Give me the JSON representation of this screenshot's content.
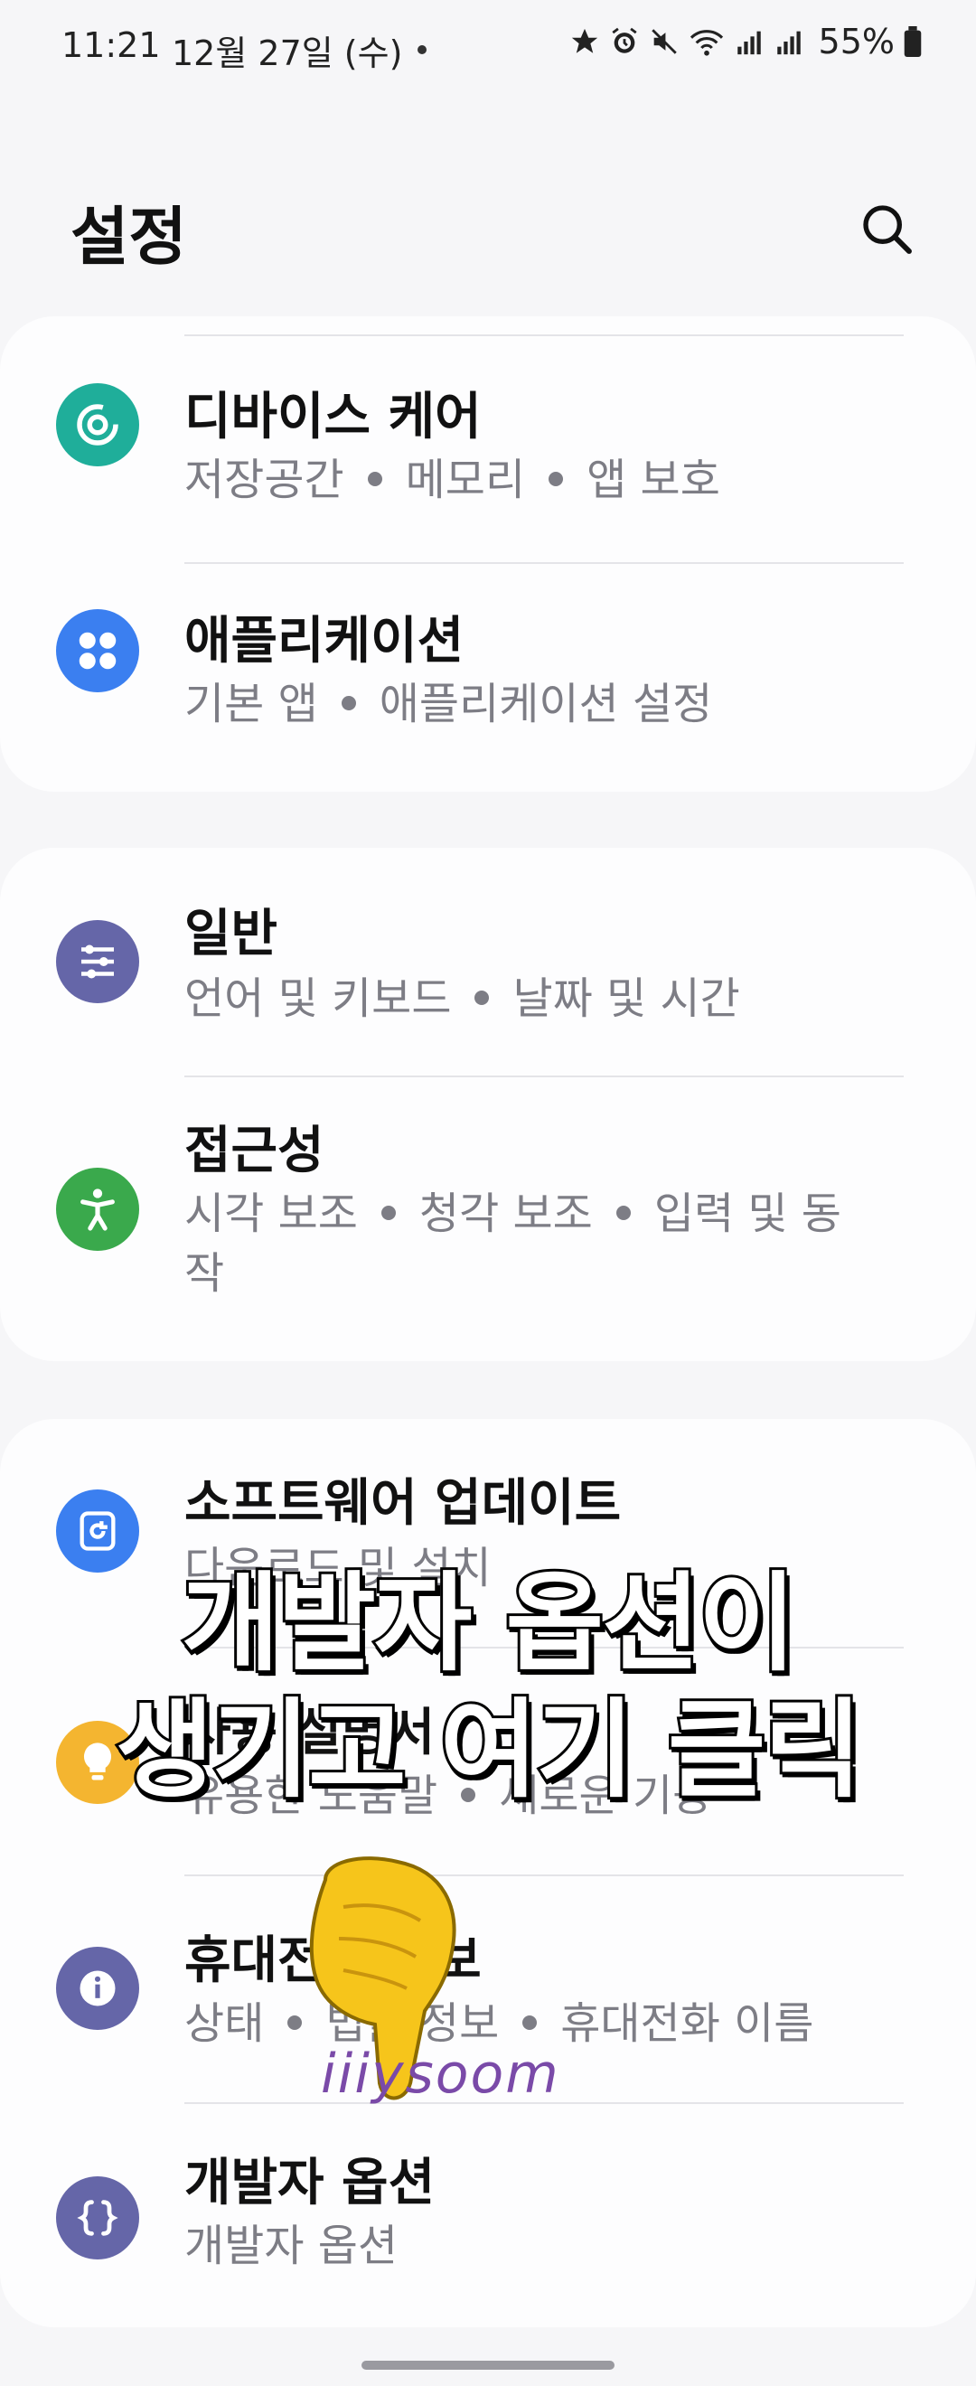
{
  "status_bar": {
    "time": "11:21",
    "date": "12월 27일 (수)",
    "battery": "55%"
  },
  "header": {
    "title": "설정"
  },
  "groups": [
    {
      "items": [
        {
          "title": "디바이스 케어",
          "subtitle": [
            "저장공간",
            "메모리",
            "앱 보호"
          ],
          "icon": "device-care-icon",
          "color": "#1fae9a"
        },
        {
          "title": "애플리케이션",
          "subtitle": [
            "기본 앱",
            "애플리케이션 설정"
          ],
          "icon": "apps-icon",
          "color": "#3b7ff0"
        }
      ]
    },
    {
      "items": [
        {
          "title": "일반",
          "subtitle": [
            "언어 및 키보드",
            "날짜 및 시간"
          ],
          "icon": "sliders-icon",
          "color": "#6566a8"
        },
        {
          "title": "접근성",
          "subtitle": [
            "시각 보조",
            "청각 보조",
            "입력 및 동작"
          ],
          "icon": "accessibility-icon",
          "color": "#3aa94c"
        }
      ]
    },
    {
      "items": [
        {
          "title": "소프트웨어 업데이트",
          "subtitle": [
            "다운로드 및 설치"
          ],
          "icon": "update-icon",
          "color": "#3b7ff0"
        },
        {
          "title": "사용 설명서",
          "subtitle": [
            "유용한 도움말",
            "새로운 기능"
          ],
          "icon": "bulb-icon",
          "color": "#f4b530"
        },
        {
          "title": "휴대전화 정보",
          "subtitle": [
            "상태",
            "법률 정보",
            "휴대전화 이름"
          ],
          "icon": "info-icon",
          "color": "#6566a8"
        },
        {
          "title": "개발자 옵션",
          "subtitle": [
            "개발자 옵션"
          ],
          "icon": "braces-icon",
          "color": "#6566a8"
        }
      ]
    }
  ],
  "overlay": {
    "caption_line1": "개발자 옵션이",
    "caption_line2": "생기고 여기 클릭",
    "watermark": "iiiysoom"
  }
}
